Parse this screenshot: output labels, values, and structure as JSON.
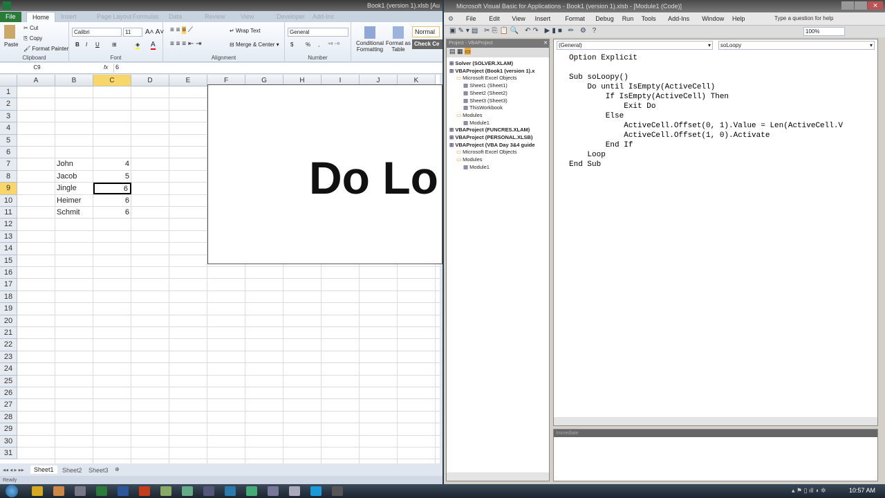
{
  "excel": {
    "title": "Book1 (version 1).xlsb [Au",
    "tabs": [
      "File",
      "Home",
      "Insert",
      "Page Layout",
      "Formulas",
      "Data",
      "Review",
      "View",
      "Developer",
      "Add-Ins"
    ],
    "ribbon": {
      "clipboard": {
        "paste": "Paste",
        "cut": "Cut",
        "copy": "Copy",
        "format_painter": "Format Painter",
        "label": "Clipboard"
      },
      "font": {
        "name": "Calibri",
        "size": "11",
        "bold": "B",
        "italic": "I",
        "underline": "U",
        "label": "Font"
      },
      "alignment": {
        "wrap": "Wrap Text",
        "merge": "Merge & Center",
        "label": "Alignment"
      },
      "number": {
        "format": "General",
        "currency": "$",
        "percent": "%",
        "comma": ",",
        "label": "Number"
      },
      "styles": {
        "conditional": "Conditional Formatting",
        "format_table": "Format as Table",
        "normal": "Normal",
        "check": "Check Ce"
      }
    },
    "name_box": "C9",
    "fx": "fx",
    "formula": "6",
    "columns": [
      "A",
      "B",
      "C",
      "D",
      "E",
      "F",
      "G",
      "H",
      "I",
      "J",
      "K"
    ],
    "selected_column": "C",
    "selected_row": 9,
    "rows": [
      1,
      2,
      3,
      4,
      5,
      6,
      7,
      8,
      9,
      10,
      11,
      12,
      13,
      14,
      15,
      16,
      17,
      18,
      19,
      20,
      21,
      22,
      23,
      24,
      25,
      26,
      27,
      28,
      29,
      30,
      31
    ],
    "data": [
      {
        "row": 7,
        "name": "John",
        "value": "4"
      },
      {
        "row": 8,
        "name": "Jacob",
        "value": "5"
      },
      {
        "row": 9,
        "name": "Jingle",
        "value": "6"
      },
      {
        "row": 10,
        "name": "Heimer",
        "value": "6"
      },
      {
        "row": 11,
        "name": "Schmit",
        "value": "6"
      }
    ],
    "textbox_text": "Do Lo",
    "sheet_tabs": [
      "Sheet1",
      "Sheet2",
      "Sheet3"
    ],
    "status": "Ready"
  },
  "vba": {
    "title": "Microsoft Visual Basic for Applications - Book1 (version 1).xlsb - [Module1 (Code)]",
    "menu": [
      "File",
      "Edit",
      "View",
      "Insert",
      "Format",
      "Debug",
      "Run",
      "Tools",
      "Add-Ins",
      "Window",
      "Help"
    ],
    "help_placeholder": "Type a question for help",
    "zoom": "100%",
    "project_title": "Project - VBAProject",
    "tree": [
      {
        "label": "Solver (SOLVER.XLAM)",
        "level": 0,
        "bold": true
      },
      {
        "label": "VBAProject (Book1 (version 1).x",
        "level": 0,
        "bold": true
      },
      {
        "label": "Microsoft Excel Objects",
        "level": 1
      },
      {
        "label": "Sheet1 (Sheet1)",
        "level": 2
      },
      {
        "label": "Sheet2 (Sheet2)",
        "level": 2
      },
      {
        "label": "Sheet3 (Sheet3)",
        "level": 2
      },
      {
        "label": "ThisWorkbook",
        "level": 2
      },
      {
        "label": "Modules",
        "level": 1
      },
      {
        "label": "Module1",
        "level": 2
      },
      {
        "label": "VBAProject (FUNCRES.XLAM)",
        "level": 0,
        "bold": true
      },
      {
        "label": "VBAProject (PERSONAL.XLSB)",
        "level": 0,
        "bold": true
      },
      {
        "label": "VBAProject (VBA Day 3&4 guide",
        "level": 0,
        "bold": true
      },
      {
        "label": "Microsoft Excel Objects",
        "level": 1
      },
      {
        "label": "Modules",
        "level": 1
      },
      {
        "label": "Module1",
        "level": 2
      }
    ],
    "object_dropdown": "(General)",
    "proc_dropdown": "soLoopy",
    "code": [
      "Option Explicit",
      "",
      "Sub soLoopy()",
      "    Do until IsEmpty(ActiveCell)",
      "        If IsEmpty(ActiveCell) Then",
      "            Exit Do",
      "        Else",
      "            ActiveCell.Offset(0, 1).Value = Len(ActiveCell.V",
      "            ActiveCell.Offset(1, 0).Activate",
      "        End If",
      "    Loop",
      "End Sub"
    ],
    "immediate_title": "Immediate"
  },
  "taskbar": {
    "clock": "10:57 AM",
    "apps": [
      "outlook",
      "chrome",
      "explorer",
      "excel",
      "word",
      "powerpoint",
      "app7",
      "app8",
      "app9",
      "app10",
      "app11",
      "app12",
      "app13",
      "skype",
      "app15"
    ]
  }
}
